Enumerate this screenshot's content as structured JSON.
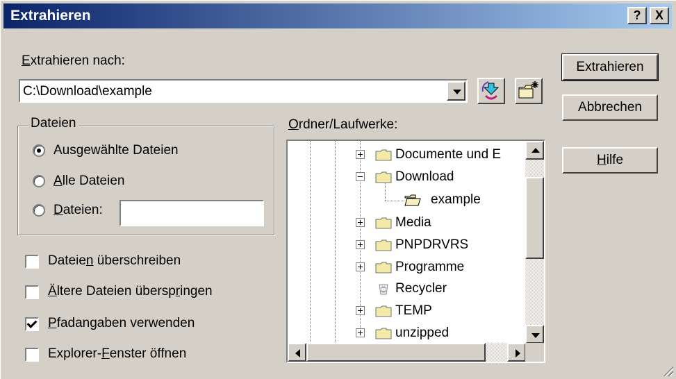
{
  "window": {
    "title": "Extrahieren",
    "help_btn": "?",
    "close_btn": "X"
  },
  "target": {
    "label_prefix": "E",
    "label_rest": "xtrahieren nach:",
    "path_value": "C:\\Download\\example"
  },
  "buttons": {
    "extract": "Extrahieren",
    "cancel": "Abbrechen",
    "help_mnemonic": "H",
    "help_rest": "ilfe"
  },
  "files_group": {
    "title": "Dateien",
    "selected_a": "Aus",
    "selected_mn": "g",
    "selected_b": "ewählte Dateien",
    "all_mn": "A",
    "all_rest": "lle Dateien",
    "files_mn": "D",
    "files_rest": "ateien:",
    "files_value": ""
  },
  "options": {
    "overwrite_a": "Dateie",
    "overwrite_mn": "n",
    "overwrite_b": " überschreiben",
    "skip_mn": "Ä",
    "skip_a": "ltere Dateien übersp",
    "skip_mn2": "r",
    "skip_b": "ingen",
    "paths_mn": "P",
    "paths_rest": "fadangaben verwenden",
    "explorer_a": "Explorer-",
    "explorer_mn": "F",
    "explorer_b": "enster öffnen",
    "states": {
      "overwrite": false,
      "skip_older": false,
      "use_paths": true,
      "open_explorer": false
    }
  },
  "tree": {
    "label_mn": "O",
    "label_rest": "rdner/Laufwerke:",
    "items": [
      {
        "label": "Documente und E",
        "expander": "plus"
      },
      {
        "label": "Download",
        "expander": "minus"
      },
      {
        "label": "example",
        "expander": "none"
      },
      {
        "label": "Media",
        "expander": "plus"
      },
      {
        "label": "PNPDRVRS",
        "expander": "plus"
      },
      {
        "label": "Programme",
        "expander": "plus"
      },
      {
        "label": "Recycler",
        "expander": "none"
      },
      {
        "label": "TEMP",
        "expander": "plus"
      },
      {
        "label": "unzipped",
        "expander": "plus"
      }
    ]
  },
  "colors": {
    "face": "#d4d0c8",
    "title_start": "#0a246a",
    "title_end": "#a6caf0",
    "folder": "#f5e9a8"
  }
}
